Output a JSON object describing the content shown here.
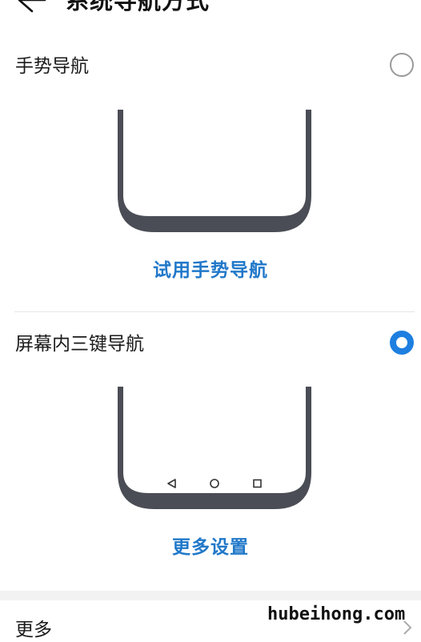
{
  "header": {
    "title": "系统导航方式",
    "back_icon": "arrow-left-icon"
  },
  "options": [
    {
      "label": "手势导航",
      "selected": false,
      "action_label": "试用手势导航"
    },
    {
      "label": "屏幕内三键导航",
      "selected": true,
      "action_label": "更多设置",
      "nav_icons": [
        "back-triangle-icon",
        "home-circle-icon",
        "recents-square-icon"
      ]
    }
  ],
  "more": {
    "label": "更多"
  },
  "watermark": "hubeihong.com",
  "colors": {
    "accent": "#1e7fe0",
    "link": "#2178c9",
    "phone_frame": "#4a4d55"
  }
}
